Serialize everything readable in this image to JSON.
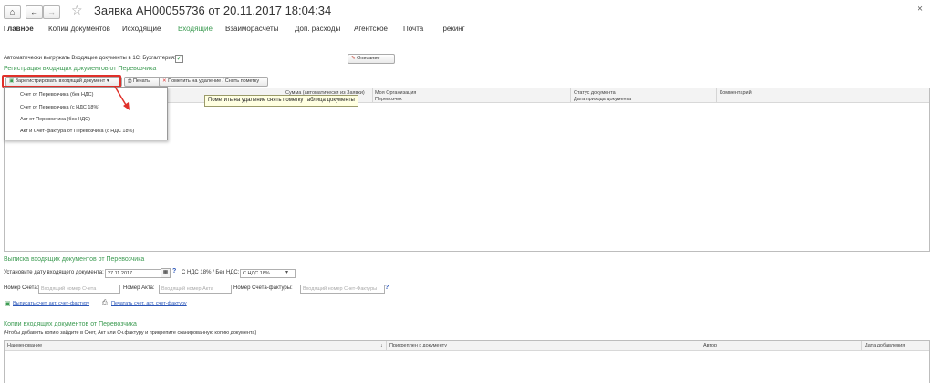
{
  "window": {
    "title": "Заявка АН00055736 от 20.11.2017 18:04:34",
    "home_icon": "home-icon",
    "back_icon": "arrow-left-icon",
    "forward_icon": "arrow-right-icon",
    "star_icon": "star-icon",
    "close_label": "×"
  },
  "tabs": [
    {
      "label": "Главное"
    },
    {
      "label": "Копии документов"
    },
    {
      "label": "Исходящие"
    },
    {
      "label": "Входящие"
    },
    {
      "label": "Взаиморасчеты"
    },
    {
      "label": "Доп. расходы"
    },
    {
      "label": "Агентское"
    },
    {
      "label": "Почта"
    },
    {
      "label": "Трекинг"
    }
  ],
  "auto_upload": {
    "label": "Автоматически выгружать Входящие документы в 1С: Бухгалтерия:",
    "checked": true,
    "check_mark": "✓"
  },
  "description_button": "Описание",
  "registration": {
    "section_title": "Регистрация входящих документов от Перевозчика",
    "register_button": "Зарегистрировать входящий документ",
    "print_button": "Печать",
    "mark_delete_button": "Пометить на удаление / Снять пометку",
    "columns": [
      "Сумма (автоматически из Заявки)",
      "Моя Организация",
      "Статус документа",
      "Комментарий"
    ],
    "subcolumns": [
      "Перевозчик",
      "Дата прихода документа"
    ],
    "tooltip": "Пометить на удаление снять пометку таблица документы",
    "dropdown_items": [
      "Счет от Перевозчика (без НДС)",
      "Счет от Перевозчика (с НДС 18%)",
      "Акт от Перевозчика (без НДС)",
      "Акт и Счет-фактура от Перевозчика (с НДС 18%)"
    ]
  },
  "statement": {
    "section_title": "Выписка входящих документов от Перевозчика",
    "date_label": "Установите дату входящего документа:",
    "date_value": "27.11.2017",
    "help": "?",
    "vat_label": "С НДС 18% / Без НДС:",
    "vat_value": "С НДС 18%",
    "invoice_label": "Номер Счета:",
    "invoice_placeholder": "Входящий номер Счета",
    "act_label": "Номер Акта:",
    "act_placeholder": "Входящий номер Акта",
    "sf_label": "Номер Счета-фактуры:",
    "sf_placeholder": "Входящий номер Счет-Фактуры",
    "issue_link": "Выписать счет, акт, счет-фактуру",
    "print_link": "Печатать счет, акт, счет-фактуру"
  },
  "copies": {
    "section_title": "Копии входящих документов от Перевозчика",
    "hint": "(Чтобы добавить копию зайдите в Счет, Акт или Сч.фактуру и прикрепите сканированную копию документа)",
    "columns": [
      "Наименование",
      "Прикреплен к документу",
      "Автор",
      "Дата добавления"
    ],
    "sort_icon": "↓"
  }
}
